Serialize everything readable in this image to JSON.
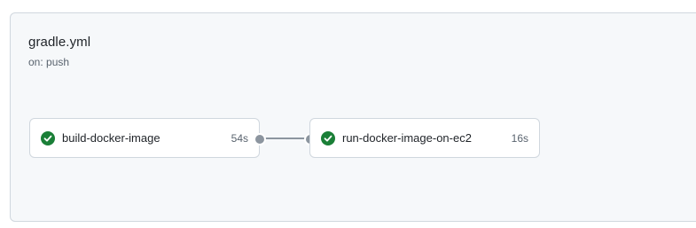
{
  "workflow": {
    "title": "gradle.yml",
    "trigger": "on: push"
  },
  "jobs": [
    {
      "name": "build-docker-image",
      "duration": "54s",
      "status": "success",
      "status_icon": "check-circle-fill-icon",
      "status_color": "#1a7f37"
    },
    {
      "name": "run-docker-image-on-ec2",
      "duration": "16s",
      "status": "success",
      "status_icon": "check-circle-fill-icon",
      "status_color": "#1a7f37"
    }
  ],
  "colors": {
    "panel_bg": "#f6f8fa",
    "border": "#d0d7de",
    "connector": "#8c959f",
    "success": "#1a7f37"
  }
}
